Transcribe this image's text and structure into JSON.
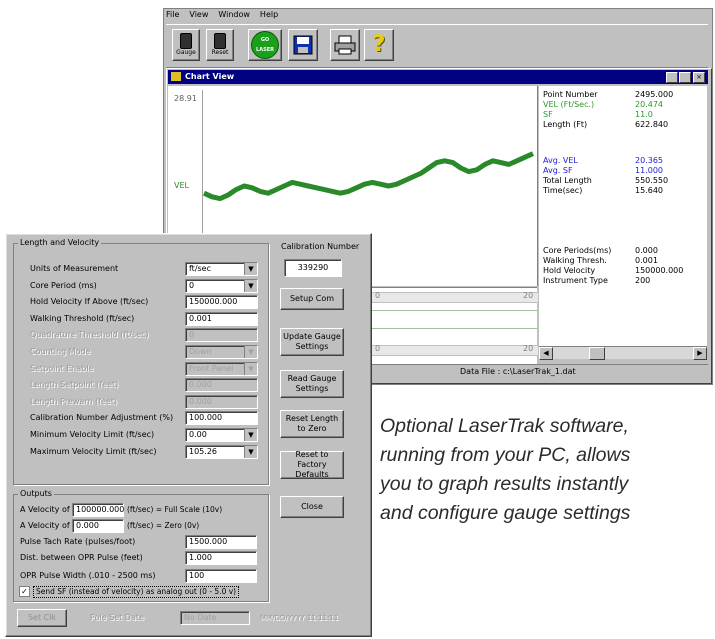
{
  "app": {
    "menu": [
      "File",
      "View",
      "Window",
      "Help"
    ],
    "toolbar": [
      {
        "label": "Gauge",
        "icon": "gauge-icon"
      },
      {
        "label": "Reset",
        "icon": "reset-icon"
      },
      {
        "label": "GO LASER",
        "icon": "go-icon"
      },
      {
        "label": "",
        "icon": "save-icon"
      },
      {
        "label": "",
        "icon": "printer-icon"
      },
      {
        "label": "",
        "icon": "help-icon"
      }
    ]
  },
  "chart_window": {
    "title": "Chart View",
    "y_top_label": "28.91",
    "y_series_label": "VEL",
    "status_bar": "Data File : c:\\LaserTrak_1.dat",
    "scroll_left_value": "0",
    "scroll_right_value": "20",
    "stats_top": [
      {
        "label": "Point Number",
        "value": "2495.000",
        "color": "#000000"
      },
      {
        "label": "VEL (Ft/Sec.)",
        "value": "20.474",
        "color": "#2a9a2a"
      },
      {
        "label": "SF",
        "value": "11.0",
        "color": "#2a9a2a"
      },
      {
        "label": "Length (Ft)",
        "value": "622.840",
        "color": "#000000"
      }
    ],
    "stats_mid": [
      {
        "label": "Avg. VEL",
        "value": "20.365",
        "color": "#2020d0"
      },
      {
        "label": "Avg. SF",
        "value": "11.000",
        "color": "#2020d0"
      },
      {
        "label": "Total Length",
        "value": "550.550",
        "color": "#000000"
      },
      {
        "label": "Time(sec)",
        "value": "15.640",
        "color": "#000000"
      }
    ],
    "stats_bottom": [
      {
        "label": "Core Periods(ms)",
        "value": "0.000"
      },
      {
        "label": "Walking Thresh.",
        "value": "0.001"
      },
      {
        "label": "Hold Velocity",
        "value": "150000.000"
      },
      {
        "label": "Instrument Type",
        "value": "200"
      }
    ]
  },
  "chart_data": {
    "type": "line",
    "title": "",
    "xlabel": "",
    "ylabel": "VEL",
    "series": [
      {
        "name": "VEL",
        "color": "#2a8a2a",
        "values": [
          0.46,
          0.44,
          0.43,
          0.45,
          0.48,
          0.5,
          0.49,
          0.47,
          0.46,
          0.48,
          0.5,
          0.52,
          0.51,
          0.5,
          0.49,
          0.48,
          0.47,
          0.46,
          0.47,
          0.49,
          0.51,
          0.52,
          0.51,
          0.5,
          0.51,
          0.53,
          0.55,
          0.57,
          0.6,
          0.63,
          0.64,
          0.63,
          0.6,
          0.58,
          0.59,
          0.62,
          0.64,
          0.63,
          0.62,
          0.64,
          0.66,
          0.68
        ]
      }
    ]
  },
  "dialog": {
    "group_length": "Length and Velocity",
    "calibration_header": "Calibration Number",
    "calibration_value": "339290",
    "rows": [
      {
        "label": "Units of Measurement",
        "value": "ft/sec",
        "dropdown": true,
        "disabled": false
      },
      {
        "label": "Core Period (ms)",
        "value": "0",
        "dropdown": true,
        "disabled": false
      },
      {
        "label": "Hold Velocity If Above (ft/sec)",
        "value": "150000.000",
        "dropdown": false,
        "disabled": false
      },
      {
        "label": "Walking Threshold (ft/sec)",
        "value": "0.001",
        "dropdown": false,
        "disabled": false
      },
      {
        "label": "Quadrature Threshold (ft/sec)",
        "value": "0",
        "dropdown": false,
        "disabled": true
      },
      {
        "label": "Counting Mode",
        "value": "Down",
        "dropdown": true,
        "disabled": true
      },
      {
        "label": "Setpoint Enable",
        "value": "Front Panel",
        "dropdown": true,
        "disabled": true
      },
      {
        "label": "Length Setpoint (feet)",
        "value": "0.000",
        "dropdown": false,
        "disabled": true
      },
      {
        "label": "Length Prewarn (feet)",
        "value": "0.000",
        "dropdown": false,
        "disabled": true
      },
      {
        "label": "Calibration Number Adjustment (%)",
        "value": "100.000",
        "dropdown": false,
        "disabled": false
      },
      {
        "label": "Minimum Velocity Limit (ft/sec)",
        "value": "0.00",
        "dropdown": true,
        "disabled": false
      },
      {
        "label": "Maximum Velocity Limit (ft/sec)",
        "value": "105.26",
        "dropdown": true,
        "disabled": false
      }
    ],
    "buttons": [
      "Setup Com",
      "Update Gauge Settings",
      "Read Gauge Settings",
      "Reset Length to Zero",
      "Reset to Factory Defaults",
      "Close"
    ],
    "group_outputs": "Outputs",
    "outputs": [
      {
        "label": "A Velocity of",
        "value": "100000.000",
        "suffix": "(ft/sec) = Full Scale (10v)"
      },
      {
        "label": "A Velocity of",
        "value": "0.000",
        "suffix": "(ft/sec) = Zero (0v)"
      },
      {
        "label": "Pulse Tach Rate (pulses/foot)",
        "value": "1500.000",
        "suffix": ""
      },
      {
        "label": "Dist. between OPR Pulse (feet)",
        "value": "1.000",
        "suffix": ""
      },
      {
        "label": "OPR Pulse Width (.010 - 2500 ms)",
        "value": "100",
        "suffix": ""
      }
    ],
    "checkbox_label": "Send SF (instead of velocity) as analog out (0 - 5.0 v)",
    "footer": {
      "left_button": "Set Clk",
      "middle_label": "Pole Set Date",
      "middle_value": "No Date",
      "right_text": "MM/DD/YYYY 11:11:11"
    }
  },
  "caption": [
    "Optional LaserTrak software,",
    "running from your PC, allows",
    "you to graph results instantly",
    "and configure gauge settings"
  ]
}
